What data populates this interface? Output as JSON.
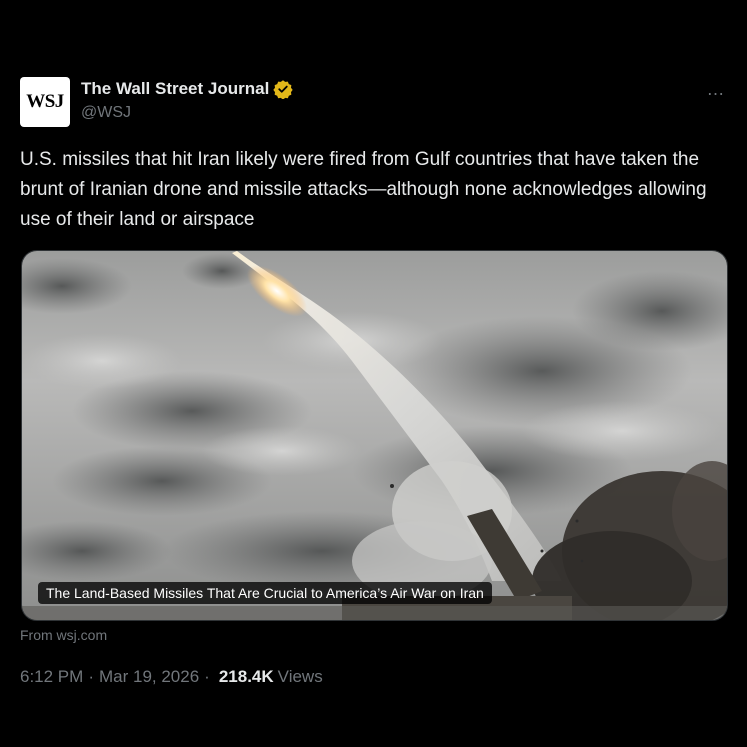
{
  "author": {
    "avatar_text": "WSJ",
    "name": "The Wall Street Journal",
    "handle": "@WSJ",
    "verified": true,
    "verified_color": "#e2b719"
  },
  "more_icon": "…",
  "tweet": {
    "text": "U.S. missiles that hit Iran likely were fired from Gulf countries that have taken the brunt of Iranian drone and missile attacks—although none acknowledges allowing use of their land or airspace"
  },
  "media": {
    "caption": "The Land-Based Missiles That Are Crucial to America’s Air War on Iran",
    "source": "From wsj.com"
  },
  "meta": {
    "time": "6:12 PM",
    "separator": "·",
    "date": "Mar 19, 2026",
    "views_count": "218.4K",
    "views_label": "Views"
  },
  "colors": {
    "background": "#000000",
    "text_primary": "#e7e9ea",
    "text_secondary": "#71767b"
  }
}
